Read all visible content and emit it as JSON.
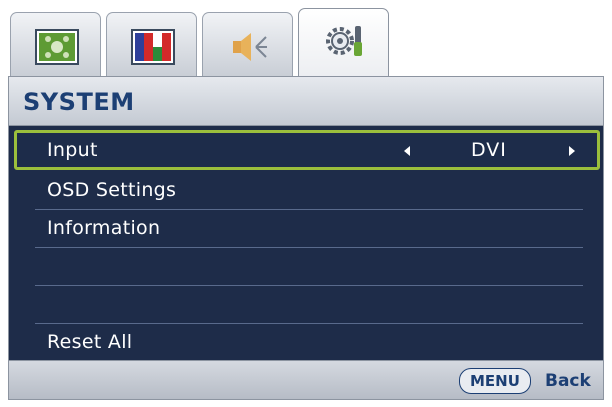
{
  "tabs": [
    {
      "icon": "picture-adjust-icon",
      "active": false
    },
    {
      "icon": "color-bars-icon",
      "active": false
    },
    {
      "icon": "speaker-volume-icon",
      "active": false
    },
    {
      "icon": "gear-wrench-icon",
      "active": true
    }
  ],
  "header": {
    "title": "SYSTEM"
  },
  "menu": {
    "items": [
      {
        "label": "Input",
        "value": "DVI",
        "selected": true
      },
      {
        "label": "OSD Settings"
      },
      {
        "label": "Information"
      },
      {
        "label": ""
      },
      {
        "label": ""
      },
      {
        "label": "Reset All"
      }
    ]
  },
  "footer": {
    "menu_button": "MENU",
    "back_label": "Back"
  },
  "colors": {
    "menu_bg": "#1e2c49",
    "selection_border": "#9bbf3c",
    "header_text": "#1c3f74",
    "item_text": "#ffffff"
  }
}
